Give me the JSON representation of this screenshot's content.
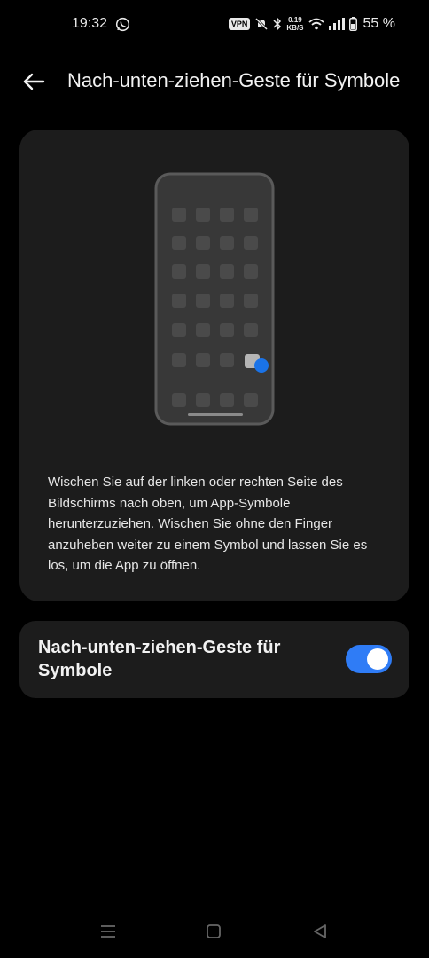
{
  "status_bar": {
    "time": "19:32",
    "vpn": "VPN",
    "net_speed_value": "0.19",
    "net_speed_unit": "KB/S",
    "battery": "55 %",
    "icons": [
      "whatsapp-icon",
      "vpn-badge",
      "mute-icon",
      "bluetooth-icon",
      "wifi-icon",
      "signal-icon",
      "battery-icon"
    ]
  },
  "header": {
    "title": "Nach-unten-ziehen-Geste für Symbole",
    "back_icon": "arrow-left-icon"
  },
  "illustration": {
    "accent_color": "#1a73e8"
  },
  "description": "Wischen Sie auf der linken oder rechten Seite des Bildschirms nach oben, um App-Symbole herunterzuziehen. Wischen Sie ohne den Finger anzuheben weiter zu einem Symbol und lassen Sie es los, um die App zu öffnen.",
  "setting": {
    "label": "Nach-unten-ziehen-Geste für Symbole",
    "enabled": true,
    "accent_color": "#2f7cf6"
  },
  "nav_bar": {
    "icons": [
      "menu-icon",
      "home-icon",
      "back-triangle-icon"
    ]
  }
}
